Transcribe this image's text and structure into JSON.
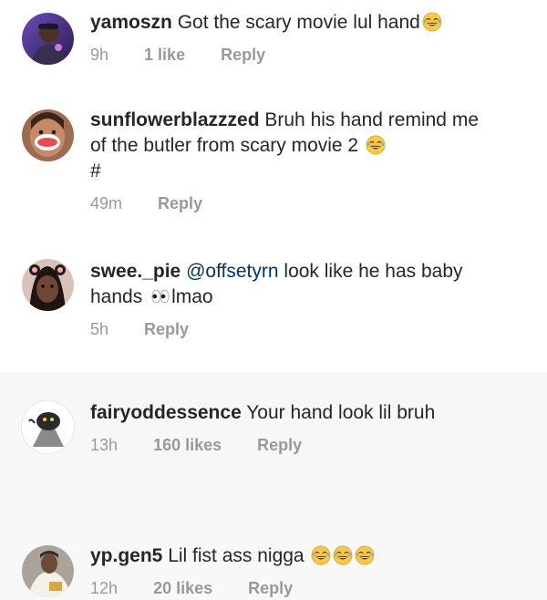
{
  "comments": [
    {
      "username": "yamoszn",
      "text": "Got the scary movie lul hand",
      "emoji": "tears-of-joy",
      "time": "9h",
      "likes": "1 like",
      "reply": "Reply"
    },
    {
      "username": "sunflowerblazzzed",
      "text_line1": "Bruh his hand remind me",
      "text_line2": "of the butler from scary movie 2",
      "emoji": "tears-of-joy",
      "text_line3": "#",
      "time": "49m",
      "reply": "Reply"
    },
    {
      "username": "swee._pie",
      "mention": "@offsetyrn",
      "text_line1": "look like he has baby",
      "text_line2a": "hands",
      "emoji": "eyes",
      "text_line2b": "lmao",
      "time": "5h",
      "reply": "Reply"
    },
    {
      "username": "fairyoddessence",
      "text": "Your hand look lil bruh",
      "time": "13h",
      "likes": "160 likes",
      "reply": "Reply"
    },
    {
      "username": "yp.gen5",
      "text": "Lil fist ass nigga",
      "emoji": "tears-of-joy x3",
      "time": "12h",
      "likes": "20 likes",
      "reply": "Reply"
    }
  ],
  "colors": {
    "text": "#262626",
    "meta": "#999999",
    "mention": "#003569",
    "highlight_bg": "#f7f7f7"
  }
}
